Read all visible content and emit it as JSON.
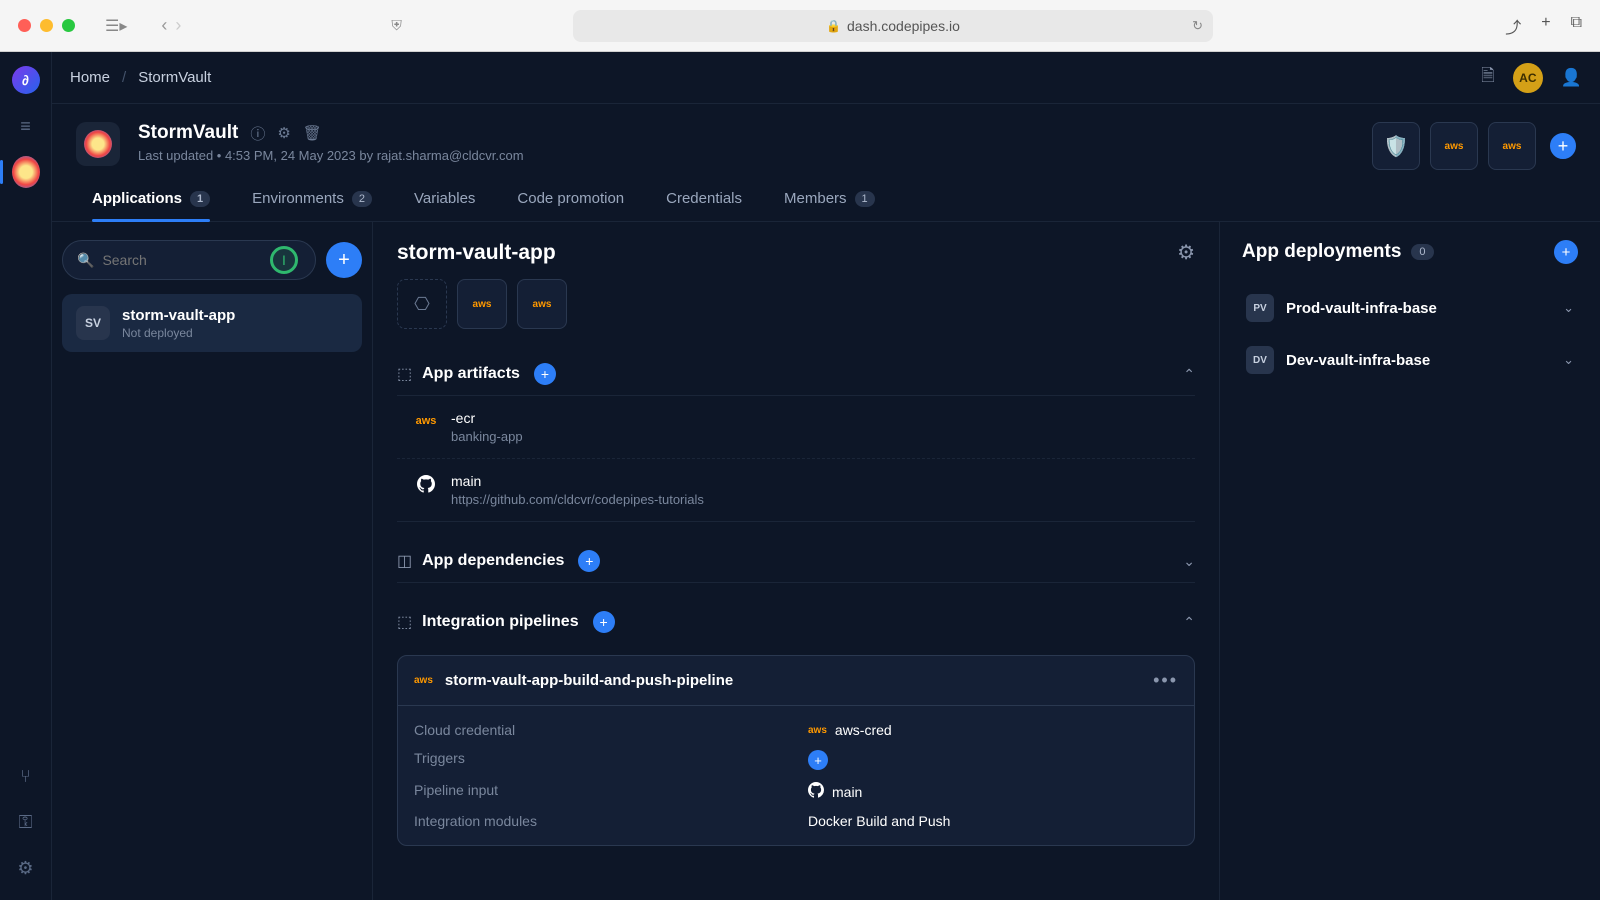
{
  "browser": {
    "url": "dash.codepipes.io"
  },
  "breadcrumbs": [
    "Home",
    "StormVault"
  ],
  "user_initials": "AC",
  "project": {
    "name": "StormVault",
    "meta": "Last updated • 4:53 PM, 24 May 2023 by rajat.sharma@cldcvr.com"
  },
  "tabs": [
    {
      "label": "Applications",
      "count": "1",
      "active": true
    },
    {
      "label": "Environments",
      "count": "2"
    },
    {
      "label": "Variables"
    },
    {
      "label": "Code promotion"
    },
    {
      "label": "Credentials"
    },
    {
      "label": "Members",
      "count": "1"
    }
  ],
  "search": {
    "placeholder": "Search"
  },
  "apps_list": [
    {
      "abbr": "SV",
      "name": "storm-vault-app",
      "status": "Not deployed"
    }
  ],
  "detail": {
    "title": "storm-vault-app",
    "artifacts_title": "App artifacts",
    "artifacts": [
      {
        "type": "aws",
        "name": "-ecr",
        "sub": "banking-app"
      },
      {
        "type": "github",
        "name": "main",
        "sub": "https://github.com/cldcvr/codepipes-tutorials"
      }
    ],
    "dependencies_title": "App dependencies",
    "pipelines_title": "Integration pipelines",
    "pipeline": {
      "name": "storm-vault-app-build-and-push-pipeline",
      "rows": {
        "cloud_cred_label": "Cloud credential",
        "cloud_cred_value": "aws-cred",
        "triggers_label": "Triggers",
        "input_label": "Pipeline input",
        "input_value": "main",
        "modules_label": "Integration modules",
        "modules_value": "Docker Build and Push"
      }
    }
  },
  "deployments": {
    "title": "App deployments",
    "count": "0",
    "items": [
      {
        "abbr": "PV",
        "name": "Prod-vault-infra-base"
      },
      {
        "abbr": "DV",
        "name": "Dev-vault-infra-base"
      }
    ]
  }
}
